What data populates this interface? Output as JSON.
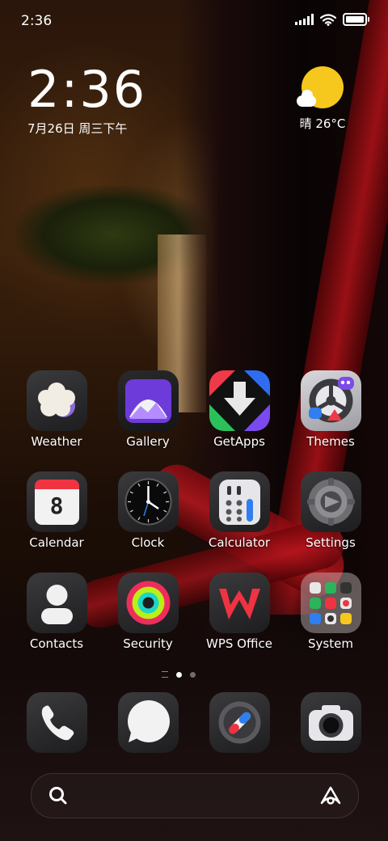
{
  "status_bar": {
    "time": "2:36"
  },
  "clock_widget": {
    "time": "2:36",
    "date": "7月26日 周三下午"
  },
  "weather_widget": {
    "text": "晴 26°C",
    "icon": "sunny-cloud-icon"
  },
  "apps": [
    {
      "label": "Weather",
      "icon": "weather-icon"
    },
    {
      "label": "Gallery",
      "icon": "gallery-icon"
    },
    {
      "label": "GetApps",
      "icon": "getapps-icon"
    },
    {
      "label": "Themes",
      "icon": "themes-icon"
    },
    {
      "label": "Calendar",
      "icon": "calendar-icon",
      "calendar_day": "8"
    },
    {
      "label": "Clock",
      "icon": "clock-icon"
    },
    {
      "label": "Calculator",
      "icon": "calculator-icon"
    },
    {
      "label": "Settings",
      "icon": "settings-icon"
    },
    {
      "label": "Contacts",
      "icon": "contacts-icon"
    },
    {
      "label": "Security",
      "icon": "security-icon"
    },
    {
      "label": "WPS Office",
      "icon": "wps-office-icon"
    },
    {
      "label": "System",
      "icon": "system-folder-icon"
    }
  ],
  "page_indicator": {
    "pages": 2,
    "active": 1
  },
  "dock": [
    {
      "icon": "phone-icon"
    },
    {
      "icon": "messages-icon"
    },
    {
      "icon": "browser-icon"
    },
    {
      "icon": "camera-icon"
    }
  ],
  "search_bar": {
    "left_icon": "search-icon",
    "right_icon": "assistant-icon"
  }
}
